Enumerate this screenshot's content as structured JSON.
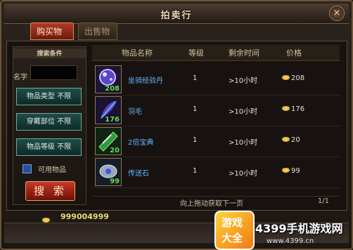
{
  "window": {
    "title": "拍卖行",
    "close_label": "×"
  },
  "tabs": [
    {
      "label": "购买物品",
      "active": true
    },
    {
      "label": "出售物品",
      "active": false
    }
  ],
  "search": {
    "title": "搜索条件",
    "name_label": "名字",
    "name_value": "",
    "filters": [
      {
        "label": "物品类型 不限"
      },
      {
        "label": "穿戴部位 不限"
      },
      {
        "label": "物品等级 不限"
      }
    ],
    "usable_label": "可用物品",
    "usable_checked": true,
    "search_button": "搜 索"
  },
  "table": {
    "headers": [
      "物品名称",
      "等级",
      "剩余时间",
      "价格"
    ],
    "rows": [
      {
        "icon": "purple-orb-icon",
        "qty": "208",
        "name": "坐骑经验丹",
        "level": "1",
        "time": ">10小时",
        "price": "208"
      },
      {
        "icon": "feather-icon",
        "qty": "176",
        "name": "羽毛",
        "level": "1",
        "time": ">10小时",
        "price": "176"
      },
      {
        "icon": "green-gem-icon",
        "qty": "20",
        "name": "2倍宝典",
        "level": "1",
        "time": ">10小时",
        "price": "20"
      },
      {
        "icon": "teleport-stone-icon",
        "qty": "99",
        "name": "传送石",
        "level": "1",
        "time": ">10小时",
        "price": "99"
      }
    ],
    "footer": "向上拖动获取下一页",
    "page": "1/1"
  },
  "wallet": {
    "gold": "999004999"
  },
  "watermark": {
    "badge_line1": "游戏",
    "badge_line2": "大全",
    "brand": "4399手机游戏网",
    "url": "www.4399.cn"
  },
  "colors": {
    "accent": "#b33a28",
    "item_name": "#5fb6ff",
    "qty": "#6be05c",
    "gold": "#e8dd74"
  }
}
